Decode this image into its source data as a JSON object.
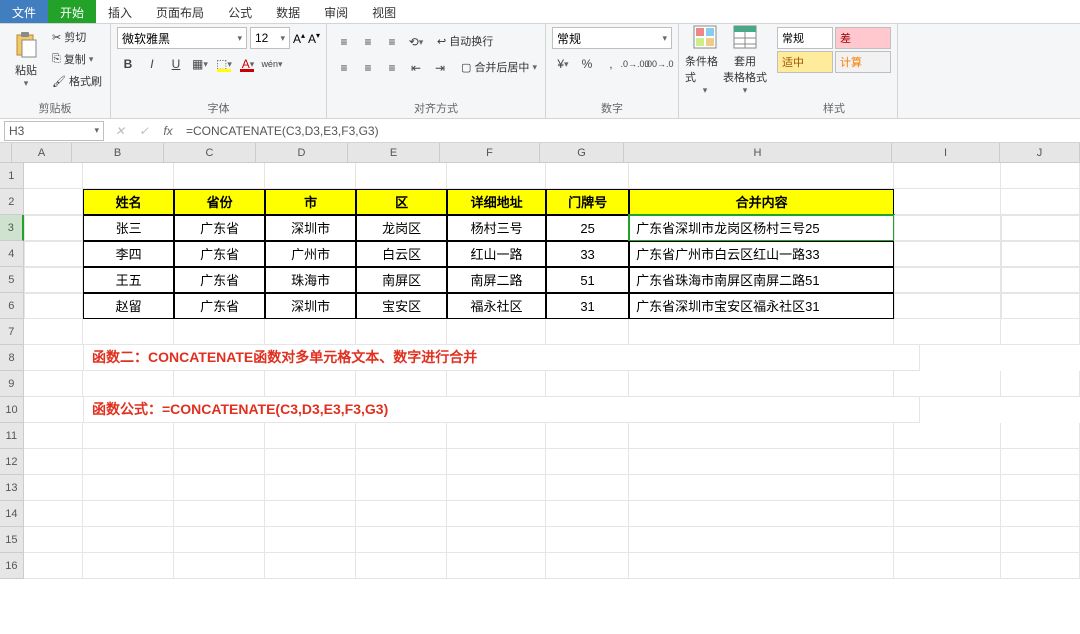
{
  "menu": {
    "file": "文件",
    "home": "开始",
    "insert": "插入",
    "layout": "页面布局",
    "formulas": "公式",
    "data": "数据",
    "review": "审阅",
    "view": "视图"
  },
  "ribbon": {
    "clipboard": {
      "paste": "粘贴",
      "cut": "剪切",
      "copy": "复制",
      "painter": "格式刷",
      "label": "剪贴板"
    },
    "font": {
      "name": "微软雅黑",
      "size": "12",
      "wen": "wén",
      "label": "字体"
    },
    "align": {
      "wrap": "自动换行",
      "merge": "合并后居中",
      "label": "对齐方式"
    },
    "number": {
      "format": "常规",
      "label": "数字"
    },
    "cond": {
      "cond_fmt": "条件格式",
      "table_fmt": "套用\n表格格式"
    },
    "styles": {
      "normal": "常规",
      "bad": "差",
      "mid": "适中",
      "calc": "计算",
      "label": "样式"
    }
  },
  "formula_bar": {
    "name_box": "H3",
    "fx": "fx",
    "formula": "=CONCATENATE(C3,D3,E3,F3,G3)"
  },
  "columns": [
    "A",
    "B",
    "C",
    "D",
    "E",
    "F",
    "G",
    "H",
    "I",
    "J"
  ],
  "table": {
    "headers": [
      "姓名",
      "省份",
      "市",
      "区",
      "详细地址",
      "门牌号",
      "合并内容"
    ],
    "rows": [
      [
        "张三",
        "广东省",
        "深圳市",
        "龙岗区",
        "杨村三号",
        "25",
        "广东省深圳市龙岗区杨村三号25"
      ],
      [
        "李四",
        "广东省",
        "广州市",
        "白云区",
        "红山一路",
        "33",
        "广东省广州市白云区红山一路33"
      ],
      [
        "王五",
        "广东省",
        "珠海市",
        "南屏区",
        "南屏二路",
        "51",
        "广东省珠海市南屏区南屏二路51"
      ],
      [
        "赵留",
        "广东省",
        "深圳市",
        "宝安区",
        "福永社区",
        "31",
        "广东省深圳市宝安区福永社区31"
      ]
    ]
  },
  "notes": {
    "line1": "函数二：CONCATENATE函数对多单元格文本、数字进行合并",
    "line2": "函数公式：=CONCATENATE(C3,D3,E3,F3,G3)"
  }
}
